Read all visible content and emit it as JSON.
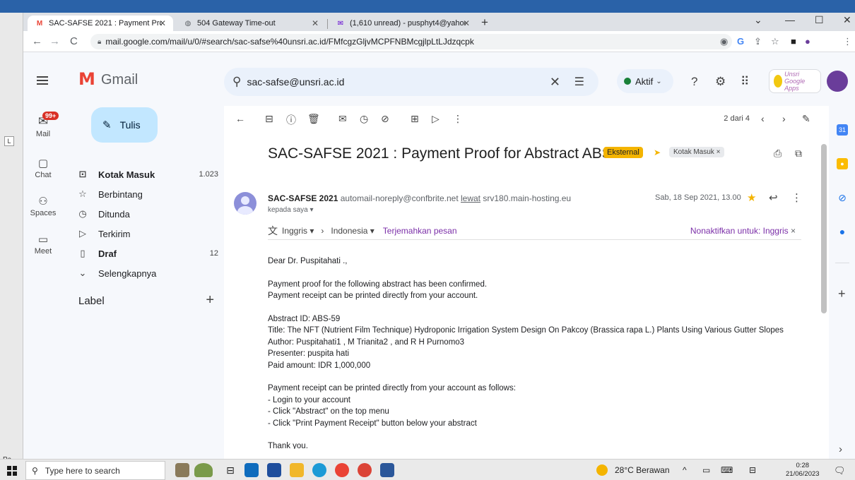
{
  "desktop": {
    "label_l": "L",
    "label_pa": "Pa"
  },
  "browser": {
    "tabs": [
      {
        "label": "SAC-SAFSE 2021 : Payment Proof",
        "icon": "gmail-icon"
      },
      {
        "label": "504 Gateway Time-out",
        "icon": "globe-icon"
      },
      {
        "label": "(1,610 unread) - pusphyt4@yahoo",
        "icon": "yahoo-mail-icon"
      }
    ],
    "url": "mail.google.com/mail/u/0/#search/sac-safse%40unsri.ac.id/FMfcgzGljvMCPFNBMcgjlpLtLJdzqcpk"
  },
  "gmail": {
    "brand": "Gmail",
    "search_value": "sac-safse@unsri.ac.id",
    "status_label": "Aktif",
    "account_badge": "Unsri Google Apps",
    "rail": {
      "mail_badge": "99+",
      "items": [
        "Mail",
        "Chat",
        "Spaces",
        "Meet"
      ]
    },
    "compose_label": "Tulis",
    "nav": {
      "items": [
        {
          "label": "Kotak Masuk",
          "count": "1.023"
        },
        {
          "label": "Berbintang",
          "count": ""
        },
        {
          "label": "Ditunda",
          "count": ""
        },
        {
          "label": "Terkirim",
          "count": ""
        },
        {
          "label": "Draf",
          "count": "12"
        },
        {
          "label": "Selengkapnya",
          "count": ""
        }
      ],
      "label_header": "Label"
    },
    "pager": "2 dari 4",
    "message": {
      "subject": "SAC-SAFSE 2021 : Payment Proof for Abstract ABS-59",
      "badge_external": "Eksternal",
      "badge_inbox": "Kotak Masuk ×",
      "sender_name": "SAC-SAFSE 2021",
      "sender_email": "automail-noreply@confbrite.net",
      "via_label": "lewat",
      "via_host": "srv180.main-hosting.eu",
      "to_line": "kepada saya ▾",
      "date": "Sab, 18 Sep 2021, 13.00",
      "translate": {
        "from_lang": "Inggris ▾",
        "to_lang": "Indonesia ▾",
        "translate_link": "Terjemahkan pesan",
        "disable_link": "Nonaktifkan untuk: Inggris"
      },
      "body": [
        "Dear Dr. Puspitahati .,",
        "",
        "Payment proof for the following abstract has been confirmed.",
        "Payment receipt can be printed directly from your account.",
        "",
        "Abstract ID: ABS-59",
        "Title: The NFT (Nutrient Film Technique) Hydroponic Irrigation System Design On Pakcoy (Brassica rapa L.) Plants Using Various Gutter Slopes",
        "Author: Puspitahati1 , M Trianita2 , and R H Purnomo3",
        "Presenter: puspita hati",
        "Paid amount: IDR 1,000,000",
        "",
        "Payment receipt can be printed directly from your account as follows:",
        "- Login to your account",
        "- Click \"Abstract\" on the top menu",
        "- Click \"Print Payment Receipt\" button below your abstract",
        "",
        "Thank you."
      ]
    }
  },
  "taskbar": {
    "search_placeholder": "Type here to search",
    "weather": "28°C Berawan",
    "time": "0:28",
    "date": "21/06/2023"
  },
  "colors": {
    "accent": "#c2e7ff",
    "external_badge": "#f4b400",
    "status_green": "#188038",
    "gmail_red": "#ea4335"
  }
}
